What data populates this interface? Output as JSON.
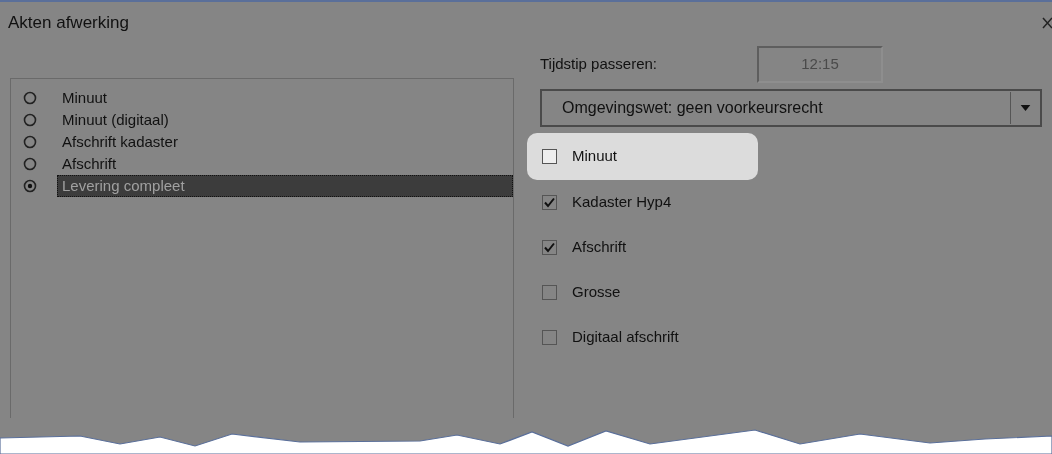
{
  "window": {
    "title": "Akten afwerking"
  },
  "radio_list": [
    {
      "label": "Minuut",
      "selected": false
    },
    {
      "label": "Minuut (digitaal)",
      "selected": false
    },
    {
      "label": "Afschrift kadaster",
      "selected": false
    },
    {
      "label": "Afschrift",
      "selected": false
    },
    {
      "label": "Levering compleet",
      "selected": true
    }
  ],
  "time_field": {
    "label": "Tijdstip passeren:",
    "value": "12:15",
    "disabled": true
  },
  "dropdown": {
    "value": "Omgevingswet: geen voorkeursrecht"
  },
  "checkboxes": [
    {
      "label": "Minuut",
      "checked": false,
      "highlighted": true
    },
    {
      "label": "Kadaster Hyp4",
      "checked": true,
      "highlighted": false
    },
    {
      "label": "Afschrift",
      "checked": true,
      "highlighted": false
    },
    {
      "label": "Grosse",
      "checked": false,
      "highlighted": false
    },
    {
      "label": "Digitaal afschrift",
      "checked": false,
      "highlighted": false
    }
  ]
}
